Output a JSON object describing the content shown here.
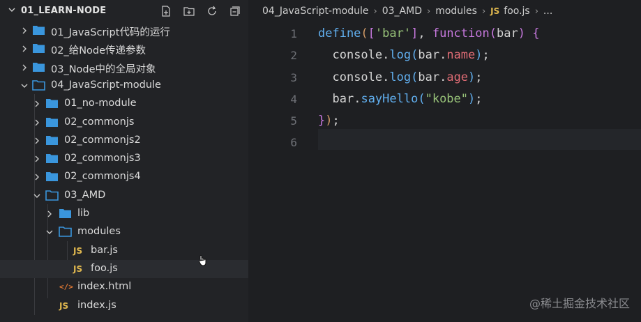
{
  "explorer": {
    "title": "01_LEARN-NODE",
    "header_icons": [
      "new-file-icon",
      "new-folder-icon",
      "refresh-icon",
      "collapse-all-icon"
    ],
    "items": [
      {
        "label": "01_JavaScript代码的运行",
        "type": "folder",
        "expanded": false,
        "depth": 1
      },
      {
        "label": "02_给Node传递参数",
        "type": "folder",
        "expanded": false,
        "depth": 1
      },
      {
        "label": "03_Node中的全局对象",
        "type": "folder",
        "expanded": false,
        "depth": 1
      },
      {
        "label": "04_JavaScript-module",
        "type": "folder",
        "expanded": true,
        "depth": 1
      },
      {
        "label": "01_no-module",
        "type": "folder",
        "expanded": false,
        "depth": 2
      },
      {
        "label": "02_commonjs",
        "type": "folder",
        "expanded": false,
        "depth": 2
      },
      {
        "label": "02_commonjs2",
        "type": "folder",
        "expanded": false,
        "depth": 2
      },
      {
        "label": "02_commonjs3",
        "type": "folder",
        "expanded": false,
        "depth": 2
      },
      {
        "label": "02_commonjs4",
        "type": "folder",
        "expanded": false,
        "depth": 2
      },
      {
        "label": "03_AMD",
        "type": "folder",
        "expanded": true,
        "depth": 2
      },
      {
        "label": "lib",
        "type": "folder",
        "expanded": false,
        "depth": 3
      },
      {
        "label": "modules",
        "type": "folder",
        "expanded": true,
        "depth": 3
      },
      {
        "label": "bar.js",
        "type": "js",
        "depth": 4
      },
      {
        "label": "foo.js",
        "type": "js",
        "depth": 4,
        "selected": true
      },
      {
        "label": "index.html",
        "type": "html",
        "depth": 3
      },
      {
        "label": "index.js",
        "type": "js",
        "depth": 3
      }
    ]
  },
  "editor": {
    "breadcrumb": [
      "04_JavaScript-module",
      "03_AMD",
      "modules"
    ],
    "breadcrumb_file": "foo.js",
    "breadcrumb_file_icon": "JS",
    "breadcrumb_more": "...",
    "line_numbers": [
      "1",
      "2",
      "3",
      "4",
      "5",
      "6"
    ],
    "code": {
      "l1": {
        "define": "define",
        "paren_open": "(",
        "bracket_open": "[",
        "str": "'bar'",
        "bracket_close": "]",
        "comma": ", ",
        "function": "function",
        "param_open": "(",
        "param": "bar",
        "param_close": ")",
        "space": " ",
        "brace_open": "{"
      },
      "l2": {
        "indent": "  ",
        "obj": "console",
        "dot": ".",
        "method": "log",
        "open": "(",
        "arg": "bar",
        "dot2": ".",
        "prop": "name",
        "close": ")",
        "semi": ";"
      },
      "l3": {
        "indent": "  ",
        "obj": "console",
        "dot": ".",
        "method": "log",
        "open": "(",
        "arg": "bar",
        "dot2": ".",
        "prop": "age",
        "close": ")",
        "semi": ";"
      },
      "l4": {
        "indent": "  ",
        "obj": "bar",
        "dot": ".",
        "method": "sayHello",
        "open": "(",
        "str": "\"kobe\"",
        "close": ")",
        "semi": ";"
      },
      "l5": {
        "brace_close": "}",
        "paren_close": ")",
        "semi": ";"
      }
    }
  },
  "js_icon_label": "JS",
  "html_icon_label": "</>",
  "watermark": "@稀土掘金技术社区",
  "colors": {
    "folder": "#3a96dd",
    "js_icon": "#e0b84f",
    "html_icon": "#e37933",
    "keyword": "#c678dd",
    "function_name": "#61afef",
    "string": "#98c379",
    "property": "#e06c75"
  }
}
